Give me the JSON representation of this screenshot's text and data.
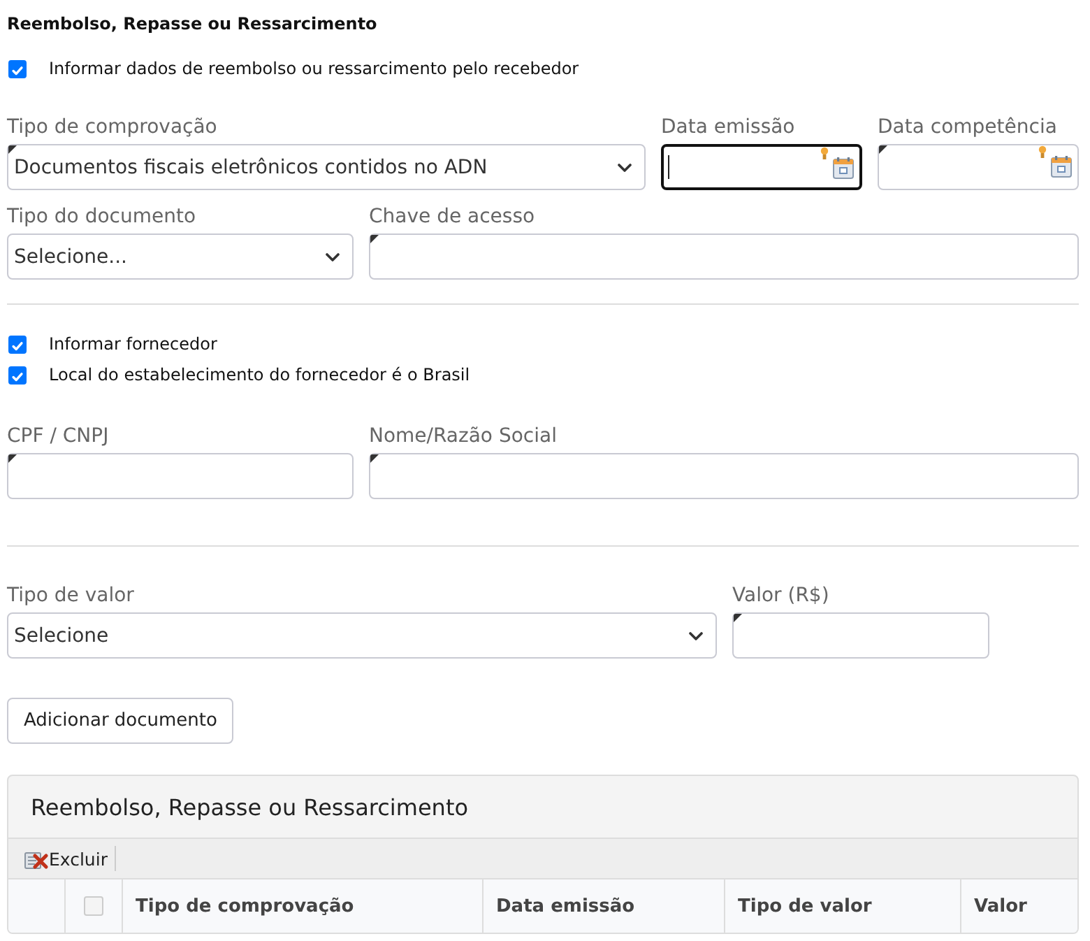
{
  "heading": "Reembolso, Repasse ou Ressarcimento",
  "reimbursement_option": {
    "label": "Informar dados de reembolso ou ressarcimento pelo recebedor",
    "checked": true
  },
  "document_rows": [
    [
      {
        "kind": "select",
        "label": "Tipo de comprovação",
        "value": "Documentos fiscais eletrônicos contidos no ADN",
        "flagged": true,
        "focused": false
      },
      {
        "kind": "date",
        "label": "Data emissão",
        "flagged": false,
        "focused": true
      },
      {
        "kind": "date",
        "label": "Data competência",
        "flagged": true,
        "focused": false
      }
    ],
    [
      {
        "kind": "select",
        "label": "Tipo do documento",
        "value": "Selecione...",
        "flagged": false,
        "focused": false
      },
      {
        "kind": "text",
        "label": "Chave de acesso",
        "flagged": true,
        "focused": false
      }
    ]
  ],
  "supplier_options": [
    {
      "label": "Informar fornecedor",
      "checked": true
    },
    {
      "label": "Local do estabelecimento do fornecedor é o Brasil",
      "checked": true
    }
  ],
  "supplier_rows": [
    [
      {
        "kind": "text",
        "label": "CPF / CNPJ",
        "flagged": true,
        "focused": false
      },
      {
        "kind": "text",
        "label": "Nome/Razão Social",
        "flagged": true,
        "focused": false
      }
    ]
  ],
  "value_rows": [
    [
      {
        "kind": "select",
        "label": "Tipo de valor",
        "value": "Selecione",
        "flagged": false,
        "focused": false
      },
      {
        "kind": "text",
        "label": "Valor (R$)",
        "flagged": true,
        "focused": false
      }
    ]
  ],
  "add_button": "Adicionar documento",
  "panel": {
    "title": "Reembolso, Repasse ou Ressarcimento",
    "toolbar": [
      {
        "label": "Excluir"
      }
    ],
    "table": {
      "select_all_checked": false,
      "columns": [
        "Tipo de comprovação",
        "Data emissão",
        "Tipo de valor",
        "Valor"
      ]
    }
  }
}
